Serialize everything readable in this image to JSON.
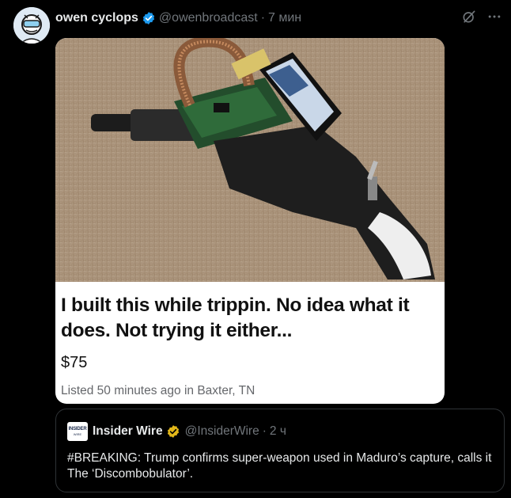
{
  "tweet": {
    "author_name": "owen cyclops",
    "author_handle": "@owenbroadcast",
    "separator": "·",
    "time": "7 мин"
  },
  "marketplace_listing": {
    "title": "I built this while trippin. No idea what it does. Not trying it either...",
    "price": "$75",
    "listed": "Listed 50 minutes ago in Baxter, TN"
  },
  "quote": {
    "avatar_line1": "INSIDER",
    "avatar_line2": "WIRE",
    "author_name": "Insider Wire",
    "author_handle": "@InsiderWire",
    "separator": "·",
    "time": "2 ч",
    "text": "#BREAKING: Trump confirms super-weapon used in Maduro’s capture, calls it The ‘Discombobulator’."
  },
  "icons": {
    "verified": "verified-badge-icon",
    "gold_verified": "gold-verified-badge-icon",
    "grok": "grok-icon",
    "more": "more-icon"
  },
  "colors": {
    "background": "#000000",
    "primary_text": "#e7e9ea",
    "secondary_text": "#71767b",
    "verified_blue": "#1d9bf0",
    "verified_gold": "#e2b719"
  }
}
